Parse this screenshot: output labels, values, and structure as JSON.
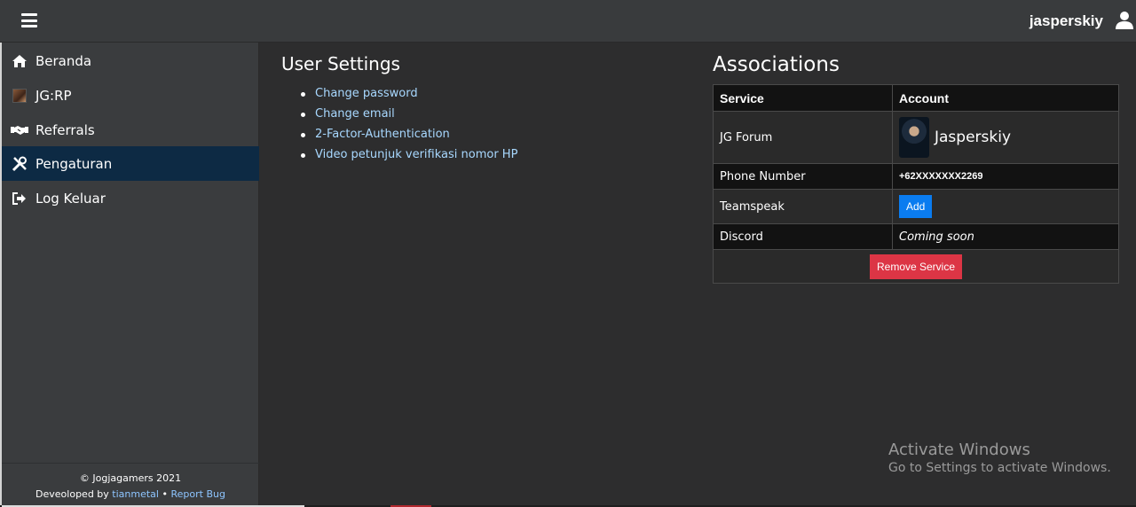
{
  "topbar": {
    "menu_icon": "hamburger-icon",
    "username": "jasperskiy",
    "user_icon": "user-icon"
  },
  "sidebar": {
    "items": [
      {
        "label": "Beranda",
        "icon": "home-icon"
      },
      {
        "label": "JG:RP",
        "icon": "jgrp-icon"
      },
      {
        "label": "Referrals",
        "icon": "handshake-icon"
      },
      {
        "label": "Pengaturan",
        "icon": "tools-icon",
        "active": true
      },
      {
        "label": "Log Keluar",
        "icon": "sign-out-icon"
      }
    ],
    "footer": {
      "copyright": "© Jogjagamers 2021",
      "developed_prefix": "Deveoloped by",
      "developer": "tianmetal",
      "separator": "•",
      "report_bug": "Report Bug"
    }
  },
  "settings": {
    "title": "User Settings",
    "links": [
      "Change password",
      "Change email",
      "2-Factor-Authentication",
      "Video petunjuk verifikasi nomor HP"
    ]
  },
  "associations": {
    "title": "Associations",
    "headers": [
      "Service",
      "Account"
    ],
    "rows": {
      "forum": {
        "service": "JG Forum",
        "account": "Jasperskiy"
      },
      "phone": {
        "service": "Phone Number",
        "account": "+62XXXXXXX2269"
      },
      "teamspeak": {
        "service": "Teamspeak",
        "action": "Add"
      },
      "discord": {
        "service": "Discord",
        "account": "Coming soon"
      }
    },
    "remove_label": "Remove Service"
  },
  "os_overlay": {
    "line1": "Activate Windows",
    "line2": "Go to Settings to activate Windows."
  },
  "colors": {
    "accent_link": "#a8d8ff",
    "active_nav": "#0d2a44",
    "add_button": "#0a7cf0",
    "remove_button": "#dc3545"
  }
}
